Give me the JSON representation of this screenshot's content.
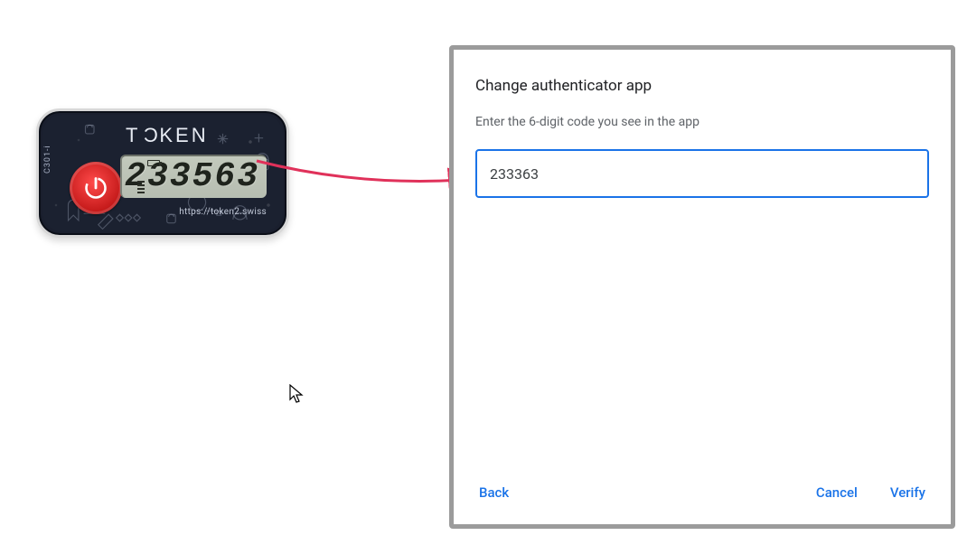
{
  "device": {
    "brand_prefix": "T",
    "brand_flip": "C",
    "brand_suffix": "KEN",
    "model": "C301-i",
    "lcd_value": "233563",
    "url": "https://token2.swiss"
  },
  "dialog": {
    "title": "Change authenticator app",
    "instruction": "Enter the 6-digit code you see in the app",
    "input_value": "233363",
    "buttons": {
      "back": "Back",
      "cancel": "Cancel",
      "verify": "Verify"
    }
  }
}
